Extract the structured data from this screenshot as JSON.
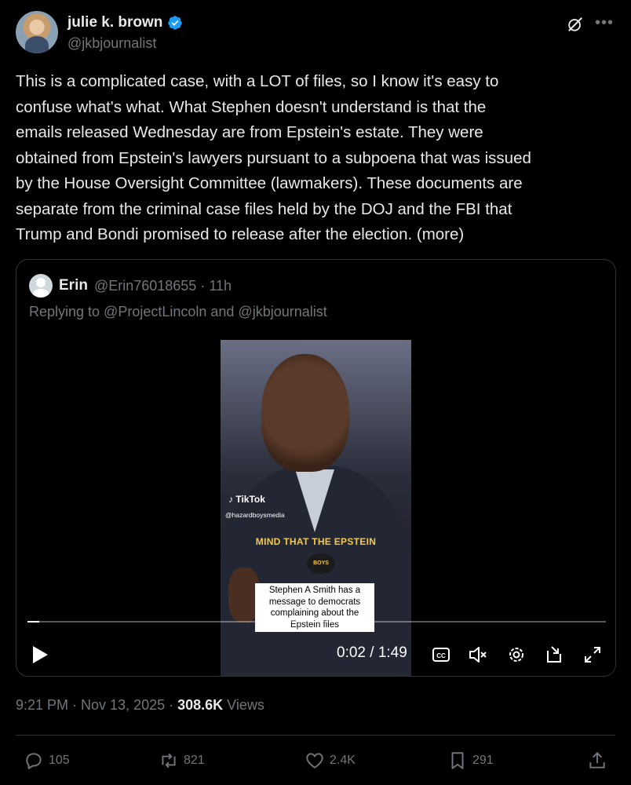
{
  "author": {
    "display_name": "julie k. brown",
    "handle": "@jkbjournalist"
  },
  "tweet_text": "This is a complicated case, with a LOT of files, so I know it's easy to\nconfuse what's what. What Stephen doesn't understand is that the\nemails released Wednesday are from Epstein's estate. They were\nobtained from Epstein's lawyers pursuant to a subpoena that was issued\nby the House Oversight Committee (lawmakers). These documents are\nseparate from the criminal case files held by the DOJ and the FBI that\nTrump and Bondi promised to release after the election. (more)",
  "quote": {
    "name": "Erin",
    "handle_time": "@Erin76018655 · 11h",
    "replying_to": "Replying to @ProjectLincoln and @jkbjournalist",
    "video": {
      "tiktok_label": "TikTok",
      "tiktok_user": "@hazardboysmedia",
      "overlay_caption": "MIND THAT THE EPSTEIN",
      "logo_text": "HAZARD BOYS MEDIA",
      "subtitle": "Stephen A Smith has a message to democrats complaining about the Epstein files",
      "time_display": "0:02 / 1:49",
      "progress_fraction": 0.02
    }
  },
  "meta": {
    "date": "9:21 PM · Nov 13, 2025 · ",
    "views_count": "308.6K",
    "views_label": " Views"
  },
  "actions": {
    "replies": "105",
    "reposts": "821",
    "likes": "2.4K",
    "bookmarks": "291"
  },
  "colors": {
    "background": "#000000",
    "text": "#e7e9ea",
    "muted": "#71767b",
    "verified": "#1d9bf0",
    "border": "#2f3336"
  },
  "icons": [
    "verified-badge-icon",
    "grok-icon",
    "more-icon",
    "play-icon",
    "cc-icon",
    "mute-icon",
    "settings-icon",
    "pip-icon",
    "fullscreen-icon",
    "reply-icon",
    "repost-icon",
    "like-icon",
    "bookmark-icon",
    "share-icon"
  ]
}
